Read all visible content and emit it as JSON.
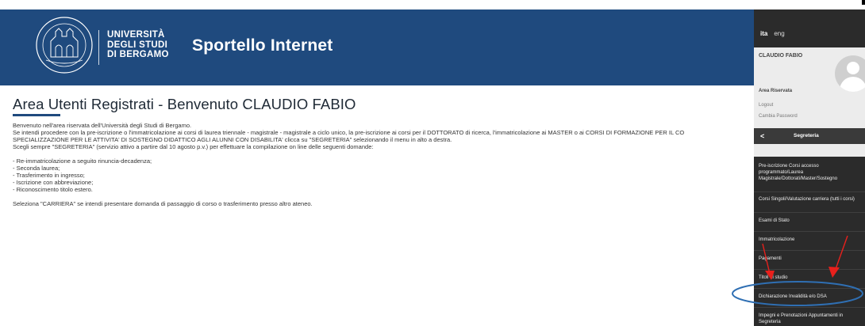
{
  "header": {
    "logo_lines": [
      "UNIVERSITÀ",
      "DEGLI STUDI",
      "DI BERGAMO"
    ],
    "seal_text": "UNIVERSITAS STUDIORUM BERGOMENSIS",
    "app_title": "Sportello Internet",
    "brand_color": "#1f4a7e"
  },
  "main": {
    "title": "Area Utenti Registrati - Benvenuto CLAUDIO FABIO",
    "paragraphs": [
      "Benvenuto nell'area riservata dell'Università degli Studi di Bergamo.",
      "Se intendi procedere con la pre-iscrizione o l'immatricolazione ai corsi di laurea triennale - magistrale - magistrale a ciclo unico, la pre-iscrizione ai corsi per il DOTTORATO di ricerca, l'immatricolazione ai MASTER o ai CORSI DI FORMAZIONE PER IL CO",
      "SPECIALIZZAZIONE PER LE ATTIVITA' DI SOSTEGNO DIDATTICO AGLI ALUNNI CON DISABILITA' clicca su \"SEGRETERIA\" selezionando il menu in alto a destra.",
      "Scegli sempre \"SEGRETERIA\" (servizio attivo a partire dal 10 agosto p.v.) per effettuare la compilazione on line delle seguenti domande:"
    ],
    "list": [
      "- Re-immatricolazione a seguito rinuncia-decadenza;",
      "- Seconda laurea;",
      "- Trasferimento in ingresso;",
      "- Iscrizione con abbreviazione;",
      "- Riconoscimento titolo estero."
    ],
    "footer_note": "Seleziona \"CARRIERA\" se intendi presentare domanda di passaggio di corso o trasferimento presso altro ateneo."
  },
  "sidebar": {
    "lang_active": "ita",
    "lang_other": "eng",
    "username": "CLAUDIO FABIO",
    "area_label": "Area Riservata",
    "logout": "Logout",
    "change_password": "Cambia Password",
    "back_icon": "chevron-left-icon",
    "back_glyph": "<",
    "section_title": "Segreteria",
    "menu": [
      "Pre-iscrizione Corsi accesso programmato/Laurea Magistrale/Dottorati/Master/Sostegno",
      "Corsi Singoli/Valutazione carriera (tutti i corsi)",
      "Esami di Stato",
      "Immatricolazione",
      "Pagamenti",
      "Titoli di studio",
      "Dichiarazione Invalidità e/o DSA",
      "Impegni e Prenotazioni Appuntamenti in Segreteria"
    ]
  },
  "annotation_colors": {
    "arrow": "#e8201c",
    "ellipse": "#2f6fb3"
  }
}
